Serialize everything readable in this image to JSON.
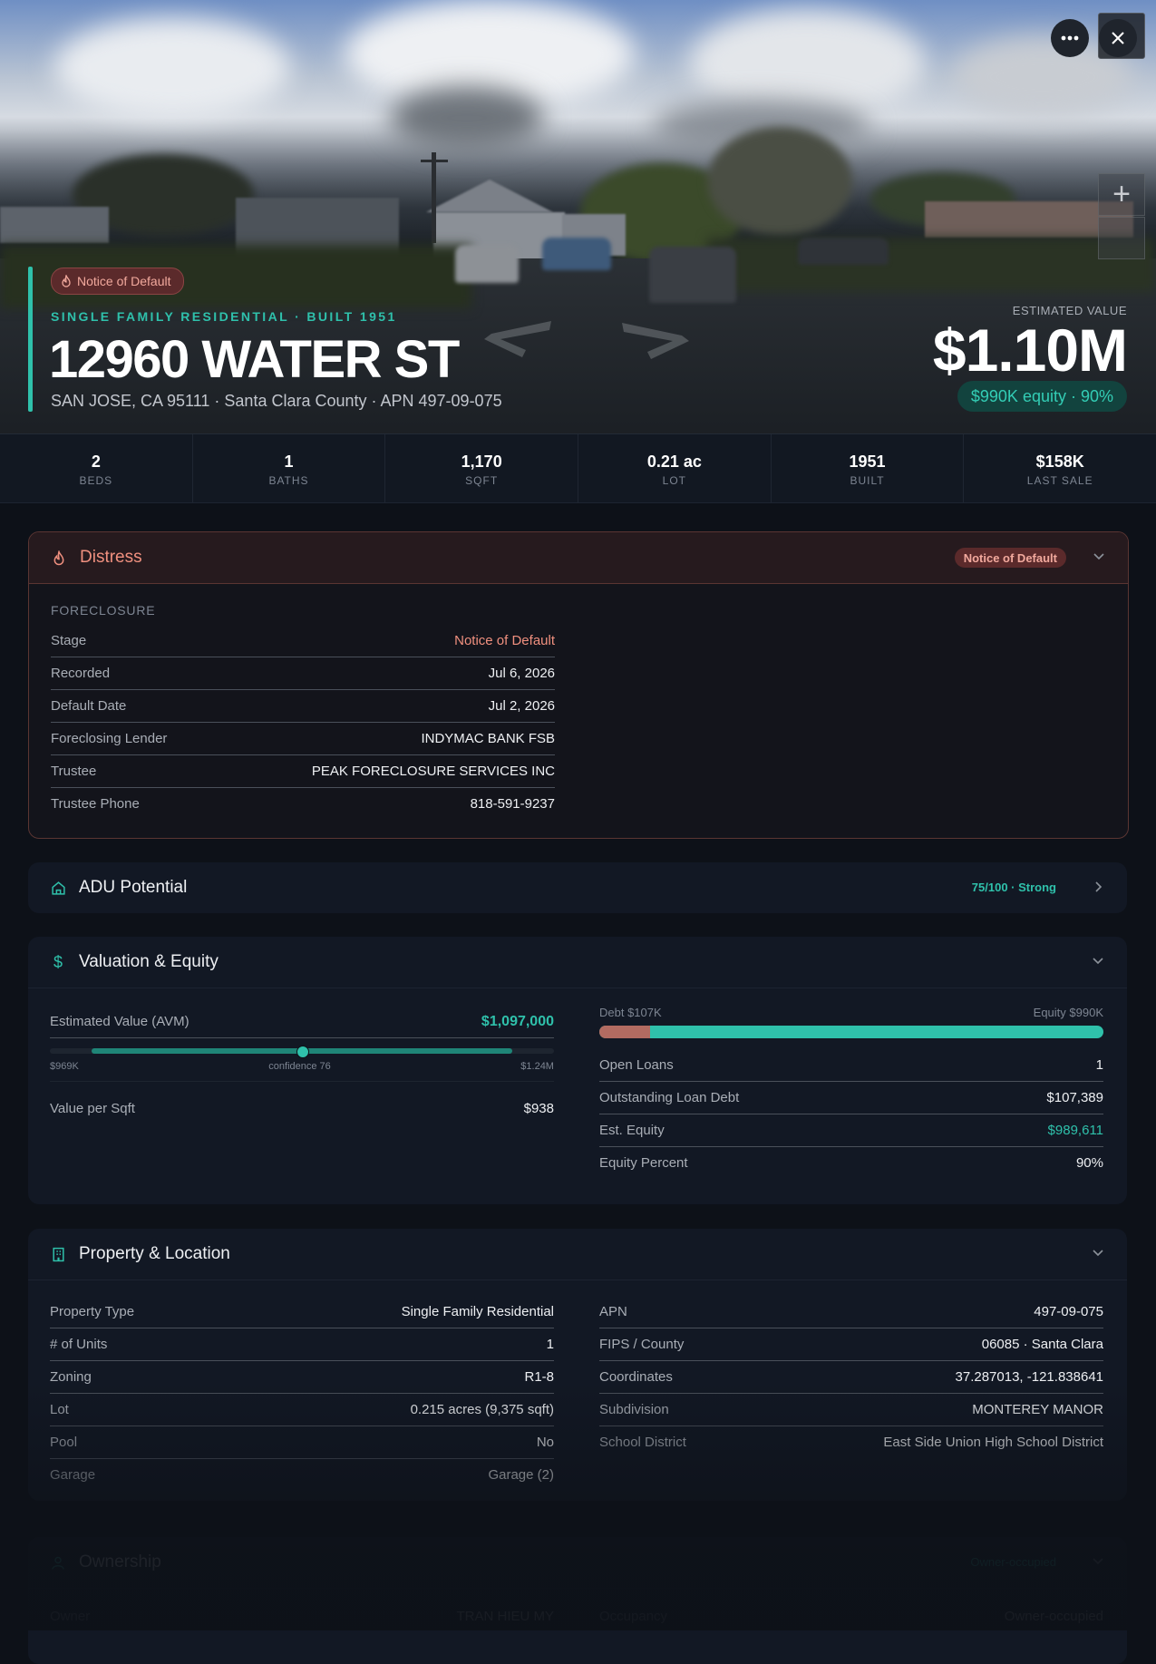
{
  "hero": {
    "badge": "Notice of Default",
    "subtitle": "SINGLE FAMILY RESIDENTIAL · BUILT 1951",
    "title": "12960 WATER ST",
    "address": "SAN JOSE, CA 95111 · Santa Clara County · APN 497-09-075",
    "estimated_label": "ESTIMATED VALUE",
    "estimated_value": "$1.10M",
    "equity_pill": "$990K equity · 90%",
    "zoom_in": "+",
    "icons": {
      "more": "more-horizontal-icon",
      "close": "close-icon",
      "zoom_in": "plus-icon"
    }
  },
  "stats": [
    {
      "value": "2",
      "label": "BEDS"
    },
    {
      "value": "1",
      "label": "BATHS"
    },
    {
      "value": "1,170",
      "label": "SQFT"
    },
    {
      "value": "0.21 ac",
      "label": "LOT"
    },
    {
      "value": "1951",
      "label": "BUILT"
    },
    {
      "value": "$158K",
      "label": "LAST SALE"
    }
  ],
  "distress": {
    "title": "Distress",
    "badge": "Notice of Default",
    "section": "FORECLOSURE",
    "rows": [
      {
        "k": "Stage",
        "v": "Notice of Default"
      },
      {
        "k": "Recorded",
        "v": "Jul 6, 2026"
      },
      {
        "k": "Default Date",
        "v": "Jul 2, 2026"
      },
      {
        "k": "Foreclosing Lender",
        "v": "INDYMAC BANK FSB"
      },
      {
        "k": "Trustee",
        "v": "PEAK FORECLOSURE SERVICES INC"
      },
      {
        "k": "Trustee Phone",
        "v": "818-591-9237"
      }
    ],
    "accent_color": "#f0907f"
  },
  "adu": {
    "title": "ADU Potential",
    "score": "75/100 · Strong"
  },
  "valuation": {
    "title": "Valuation & Equity",
    "avm_label": "Estimated Value (AVM)",
    "avm_value": "$1,097,000",
    "range_low": "$969K",
    "range_mid": "confidence 76",
    "range_high": "$1.24M",
    "avm_position_fraction": 0.5,
    "confidence": 76,
    "vps_label": "Value per Sqft",
    "vps_value": "$938",
    "debt_label": "Debt $107K",
    "equity_label": "Equity $990K",
    "debt_fraction": 0.1,
    "rows": [
      {
        "k": "Open Loans",
        "v": "1"
      },
      {
        "k": "Outstanding Loan Debt",
        "v": "$107,389"
      },
      {
        "k": "Est. Equity",
        "v": "$989,611"
      },
      {
        "k": "Equity Percent",
        "v": "90%"
      }
    ],
    "equity_color": "#2fc1ab",
    "debt_color": "#b26b61"
  },
  "property": {
    "title": "Property & Location",
    "left": [
      {
        "k": "Property Type",
        "v": "Single Family Residential"
      },
      {
        "k": "# of Units",
        "v": "1"
      },
      {
        "k": "Zoning",
        "v": "R1-8"
      },
      {
        "k": "Lot",
        "v": "0.215 acres (9,375 sqft)"
      },
      {
        "k": "Pool",
        "v": "No"
      },
      {
        "k": "Garage",
        "v": "Garage (2)"
      }
    ],
    "right": [
      {
        "k": "APN",
        "v": "497-09-075"
      },
      {
        "k": "FIPS / County",
        "v": "06085 · Santa Clara"
      },
      {
        "k": "Coordinates",
        "v": "37.287013, -121.838641"
      },
      {
        "k": "Subdivision",
        "v": "MONTEREY MANOR"
      },
      {
        "k": "School District",
        "v": "East Side Union High School District"
      }
    ]
  },
  "ownership": {
    "title": "Ownership",
    "badge": "Owner-occupied",
    "row_left": {
      "k": "Owner",
      "v": "TRAN HIEU MY"
    },
    "row_right": {
      "k": "Occupancy",
      "v": "Owner-occupied"
    }
  }
}
